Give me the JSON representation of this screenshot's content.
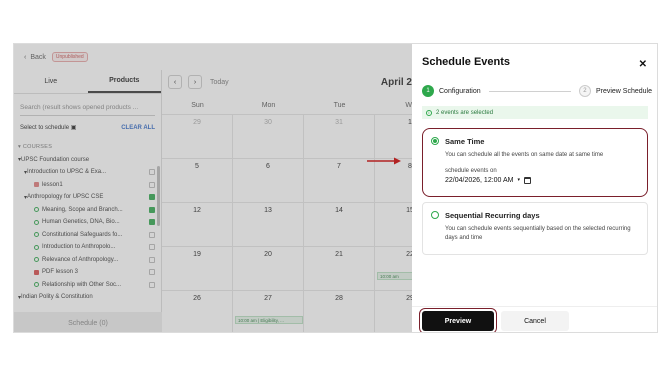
{
  "app": {
    "back_label": "Back",
    "status_badge": "Unpublished",
    "tabs": [
      "Live",
      "Products"
    ],
    "search_placeholder": "Search (result shows opened products ...",
    "select_label": "Select to schedule",
    "clear_all": "CLEAR ALL",
    "section_label": "COURSES",
    "tree": [
      {
        "label": "UPSC Foundation course",
        "indent": 4,
        "prefix": "▾ "
      },
      {
        "label": "Introduction to UPSC & Exa...",
        "indent": 10,
        "prefix": "▾ "
      },
      {
        "label": "lesson1",
        "indent": 20,
        "prefix": "",
        "icon": "video"
      },
      {
        "label": "Anthropology for UPSC CSE",
        "indent": 10,
        "prefix": "▾ ",
        "checked": true
      },
      {
        "label": "Meaning, Scope and Branch...",
        "indent": 20,
        "prefix": "",
        "icon": "lesson",
        "checked": true
      },
      {
        "label": "Human Genetics, DNA, Bio...",
        "indent": 20,
        "prefix": "",
        "icon": "lesson",
        "checked": true
      },
      {
        "label": "Constitutional Safeguards fo...",
        "indent": 20,
        "prefix": "",
        "icon": "lesson"
      },
      {
        "label": "Introduction to Anthropolo...",
        "indent": 20,
        "prefix": "",
        "icon": "lesson"
      },
      {
        "label": "Relevance of Anthropology...",
        "indent": 20,
        "prefix": "",
        "icon": "lesson"
      },
      {
        "label": "PDF lesson 3",
        "indent": 20,
        "prefix": "",
        "icon": "pdf"
      },
      {
        "label": "Relationship with Other Soc...",
        "indent": 20,
        "prefix": "",
        "icon": "lesson"
      },
      {
        "label": "Indian Polity & Constitution",
        "indent": 4,
        "prefix": "▾ "
      }
    ],
    "schedule_button": "Schedule (0)",
    "calendar": {
      "today_label": "Today",
      "month_label": "April 2",
      "weekdays": [
        "Sun",
        "Mon",
        "Tue",
        "We"
      ],
      "weeks": [
        [
          "29",
          "30",
          "31",
          "1"
        ],
        [
          "5",
          "6",
          "7",
          "8"
        ],
        [
          "12",
          "13",
          "14",
          "15"
        ],
        [
          "19",
          "20",
          "21",
          "22"
        ],
        [
          "26",
          "27",
          "28",
          "29"
        ]
      ],
      "events": {
        "wed_22": "10:00 am",
        "mon_27": "10:00 am | Eligibility, ..."
      }
    }
  },
  "modal": {
    "title": "Schedule Events",
    "steps": [
      {
        "num": "1",
        "label": "Configuration"
      },
      {
        "num": "2",
        "label": "Preview Schedule"
      }
    ],
    "info": "2 events are selected",
    "options": [
      {
        "title": "Same Time",
        "description": "You can schedule all the events on same date at same time",
        "field_label": "schedule events on",
        "datetime": "22/04/2026, 12:00  AM"
      },
      {
        "title": "Sequential Recurring days",
        "description": "You can schedule events sequentially based on the selected recurring days and time"
      }
    ],
    "preview_button": "Preview",
    "cancel_button": "Cancel"
  },
  "colors": {
    "accent_green": "#2ea84c",
    "highlight": "#7a1f2b",
    "arrow": "#b22222"
  }
}
